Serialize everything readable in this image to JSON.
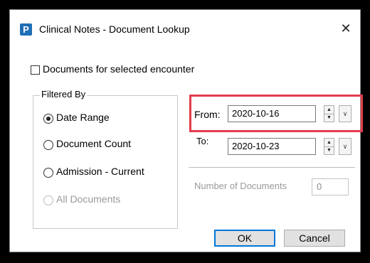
{
  "window": {
    "title": "Clinical Notes - Document Lookup",
    "app_icon_letter": "P",
    "close_glyph": "✕"
  },
  "encounter_checkbox": {
    "label": "Documents for selected encounter",
    "checked": false
  },
  "filter_group": {
    "legend": "Filtered By",
    "options": [
      {
        "label": "Date Range",
        "selected": true,
        "enabled": true
      },
      {
        "label": "Document Count",
        "selected": false,
        "enabled": true
      },
      {
        "label": "Admission - Current",
        "selected": false,
        "enabled": true
      },
      {
        "label": "All Documents",
        "selected": false,
        "enabled": false
      }
    ]
  },
  "date_range": {
    "from_label": "From:",
    "from_value": "2020-10-16",
    "to_label": "To:",
    "to_value": "2020-10-23"
  },
  "document_count": {
    "label": "Number of Documents",
    "value": "0"
  },
  "buttons": {
    "ok": "OK",
    "cancel": "Cancel"
  },
  "colors": {
    "highlight": "#e23c4b",
    "app_icon": "#1f6fb6",
    "default_button_border": "#0078d7"
  }
}
